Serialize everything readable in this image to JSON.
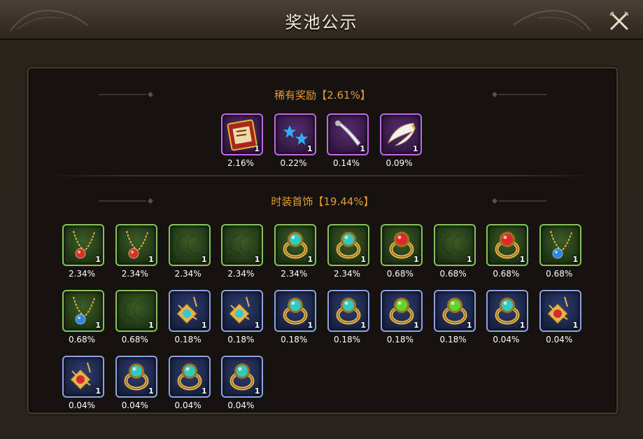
{
  "window": {
    "title": "奖池公示"
  },
  "rare": {
    "title": "稀有奖励【2.61%】",
    "items": [
      {
        "icon": "red-book-icon",
        "count": "1",
        "percent": "2.16%"
      },
      {
        "icon": "sparkle-stars-icon",
        "count": "1",
        "percent": "0.22%"
      },
      {
        "icon": "white-blade-icon",
        "count": "1",
        "percent": "0.14%"
      },
      {
        "icon": "angel-wing-icon",
        "count": "1",
        "percent": "0.09%"
      }
    ]
  },
  "costume": {
    "title": "时装首饰【19.44%】",
    "items": [
      {
        "icon": "red-gem-necklace-icon",
        "count": "1",
        "percent": "2.34%"
      },
      {
        "icon": "red-gem-necklace-icon",
        "count": "1",
        "percent": "2.34%"
      },
      {
        "icon": "green-moon-earrings-icon",
        "count": "1",
        "percent": "2.34%"
      },
      {
        "icon": "green-moon-earrings-icon",
        "count": "1",
        "percent": "2.34%"
      },
      {
        "icon": "teal-gem-ring-icon",
        "count": "1",
        "percent": "2.34%"
      },
      {
        "icon": "teal-gem-ring-icon",
        "count": "1",
        "percent": "2.34%"
      },
      {
        "icon": "red-gem-ring-icon",
        "count": "1",
        "percent": "0.68%"
      },
      {
        "icon": "blue-moon-earrings-icon",
        "count": "1",
        "percent": "0.68%"
      },
      {
        "icon": "red-gem-ring-icon",
        "count": "1",
        "percent": "0.68%"
      },
      {
        "icon": "blue-gem-necklace-icon",
        "count": "1",
        "percent": "0.68%"
      },
      {
        "icon": "blue-gem-necklace-icon",
        "count": "1",
        "percent": "0.68%"
      },
      {
        "icon": "blue-moon-earrings-icon",
        "count": "1",
        "percent": "0.68%"
      },
      {
        "icon": "teal-flower-pendant-icon",
        "count": "1",
        "percent": "0.18%"
      },
      {
        "icon": "teal-flower-pendant-icon",
        "count": "1",
        "percent": "0.18%"
      },
      {
        "icon": "gold-star-earrings-icon",
        "count": "1",
        "percent": "0.18%"
      },
      {
        "icon": "gold-star-earrings-icon",
        "count": "1",
        "percent": "0.18%"
      },
      {
        "icon": "green-gem-ring-icon",
        "count": "1",
        "percent": "0.18%"
      },
      {
        "icon": "green-gem-ring-icon",
        "count": "1",
        "percent": "0.18%"
      },
      {
        "icon": "teal-gem-ring-icon",
        "count": "1",
        "percent": "0.04%"
      },
      {
        "icon": "red-flower-pendant-icon",
        "count": "1",
        "percent": "0.04%"
      },
      {
        "icon": "red-flower-pendant-icon",
        "count": "1",
        "percent": "0.04%"
      },
      {
        "icon": "blue-star-earrings-icon",
        "count": "1",
        "percent": "0.04%"
      },
      {
        "icon": "blue-star-earrings-icon",
        "count": "1",
        "percent": "0.04%"
      },
      {
        "icon": "teal-gem-ring-icon",
        "count": "1",
        "percent": "0.04%"
      }
    ]
  },
  "colors": {
    "section_title": "#e79a2f",
    "green_frame": "#86c45a",
    "blue_frame": "#8ea2e6",
    "purple_frame": "#c16ae6"
  }
}
